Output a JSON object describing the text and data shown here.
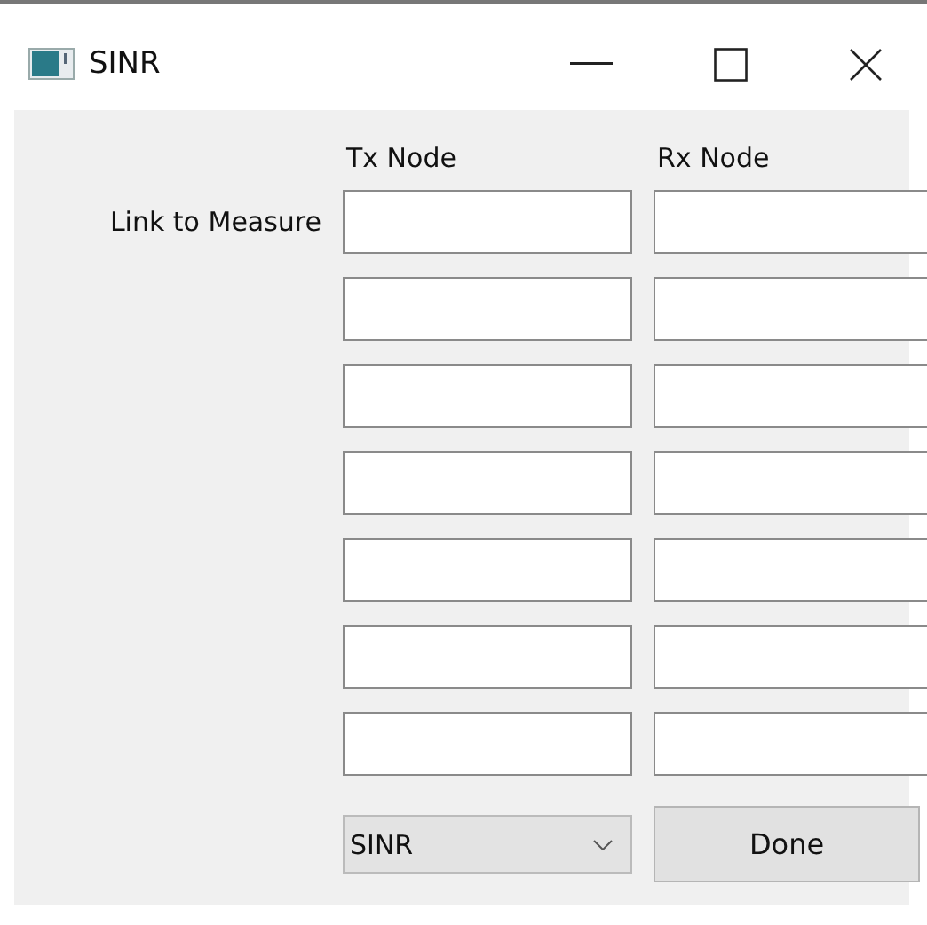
{
  "window": {
    "title": "SINR"
  },
  "columns": [
    "Tx Node",
    "Rx Node"
  ],
  "row_label": "Link to Measure",
  "rows": [
    {
      "kind": "entry"
    },
    {
      "kind": "entry"
    },
    {
      "kind": "entry"
    },
    {
      "kind": "entry"
    },
    {
      "kind": "entry"
    },
    {
      "kind": "entry"
    },
    {
      "kind": "entry"
    }
  ],
  "metric_dropdown": {
    "value": "SINR"
  },
  "buttons": [
    "Done"
  ]
}
